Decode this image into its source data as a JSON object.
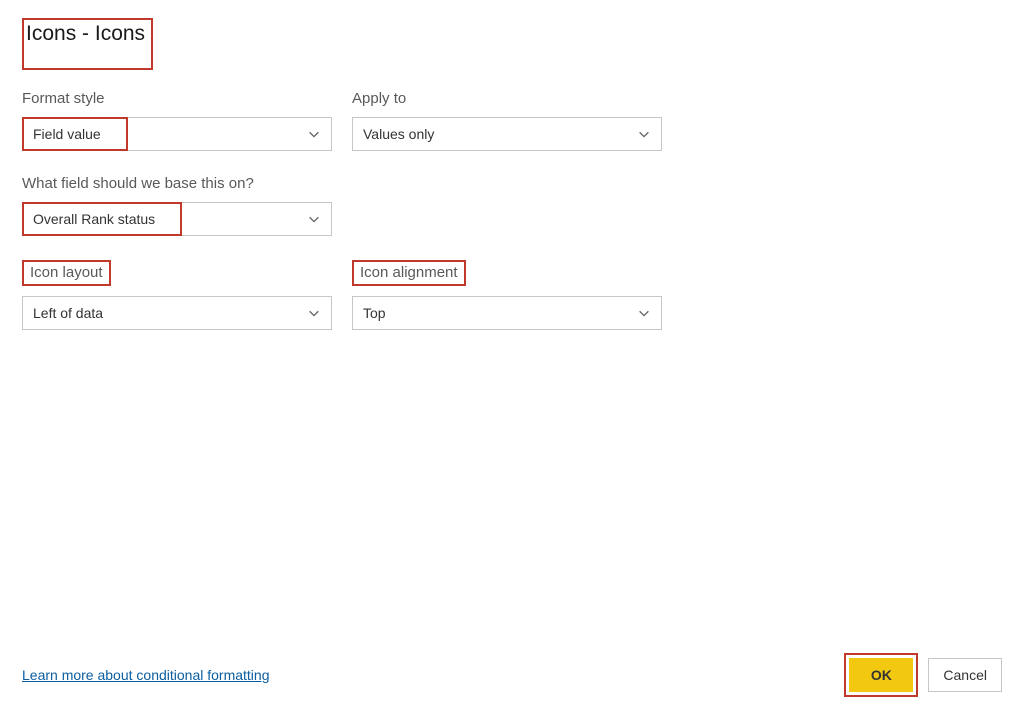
{
  "dialog": {
    "title": "Icons - Icons"
  },
  "fields": {
    "format_style": {
      "label": "Format style",
      "value": "Field value"
    },
    "apply_to": {
      "label": "Apply to",
      "value": "Values only"
    },
    "base_field": {
      "label": "What field should we base this on?",
      "value": "Overall Rank status"
    },
    "icon_layout": {
      "label": "Icon layout",
      "value": "Left of data"
    },
    "icon_alignment": {
      "label": "Icon alignment",
      "value": "Top"
    }
  },
  "footer": {
    "link": "Learn more about conditional formatting",
    "ok": "OK",
    "cancel": "Cancel"
  }
}
